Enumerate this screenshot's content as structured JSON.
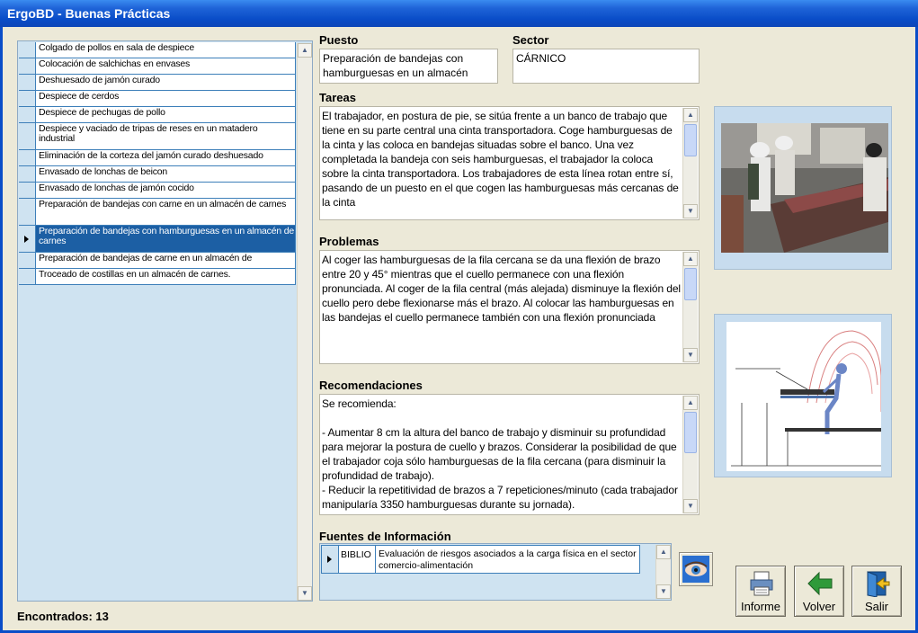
{
  "window": {
    "title": "ErgoBD -  Buenas Prácticas"
  },
  "list": {
    "items": [
      "Colgado de pollos en sala de despiece",
      "Colocación de salchichas en envases",
      "Deshuesado de jamón curado",
      "Despiece de cerdos",
      "Despiece de pechugas de pollo",
      "Despiece y vaciado de tripas de reses en un matadero industrial",
      "Eliminación de la corteza del jamón curado deshuesado",
      "Envasado de lonchas de beicon",
      "Envasado de lonchas de jamón cocido",
      "Preparación de bandejas con carne en un almacén de carnes",
      "Preparación de bandejas con hamburguesas en un almacén de carnes",
      "Preparación de bandejas de carne en un almacén de",
      "Troceado de costillas en un almacén de carnes."
    ],
    "selected_index": 10
  },
  "puesto": {
    "label": "Puesto",
    "value": "Preparación de bandejas con hamburguesas en un almacén"
  },
  "sector": {
    "label": "Sector",
    "value": "CÁRNICO"
  },
  "tareas": {
    "label": "Tareas",
    "text": "El trabajador, en postura de pie, se sitúa frente a un banco de trabajo que tiene en su parte central una cinta transportadora. Coge hamburguesas de la cinta y las coloca en bandejas situadas sobre el banco. Una vez completada la bandeja con seis hamburguesas, el trabajador la coloca sobre la cinta transportadora. Los trabajadores de esta línea rotan entre sí, pasando de un puesto en el que cogen las hamburguesas más cercanas de la cinta"
  },
  "problemas": {
    "label": "Problemas",
    "text": "Al coger las hamburguesas de la fila cercana se da una flexión de brazo entre 20 y 45° mientras que el cuello permanece con una flexión pronunciada. Al coger de la fila central (más alejada) disminuye la flexión del cuello pero debe flexionarse más el brazo. Al colocar las hamburguesas en las bandejas el cuello permanece también con una flexión pronunciada"
  },
  "recomendaciones": {
    "label": "Recomendaciones",
    "text": "Se recomienda:\n\n- Aumentar 8 cm la altura del banco de trabajo y disminuir su profundidad para mejorar la postura de cuello y brazos. Considerar la posibilidad de que el trabajador coja sólo hamburguesas de la fila cercana (para disminuir la profundidad de trabajo).\n- Reducir la repetitividad de brazos a 7 repeticiones/minuto (cada trabajador manipularía 3350 hamburguesas durante su jornada)."
  },
  "fuentes": {
    "label": "Fuentes de Información",
    "rows": [
      {
        "code": "BIBLIO",
        "desc": "Evaluación de riesgos asociados a la carga física en el sector comercio-alimentación"
      }
    ]
  },
  "buttons": {
    "informe": "Informe",
    "volver": "Volver",
    "salir": "Salir"
  },
  "status": {
    "count_text": "Encontrados: 13"
  },
  "icons": {
    "eye": "eye-icon",
    "printer": "printer-icon",
    "back": "back-arrow-icon",
    "exit": "exit-door-icon"
  }
}
